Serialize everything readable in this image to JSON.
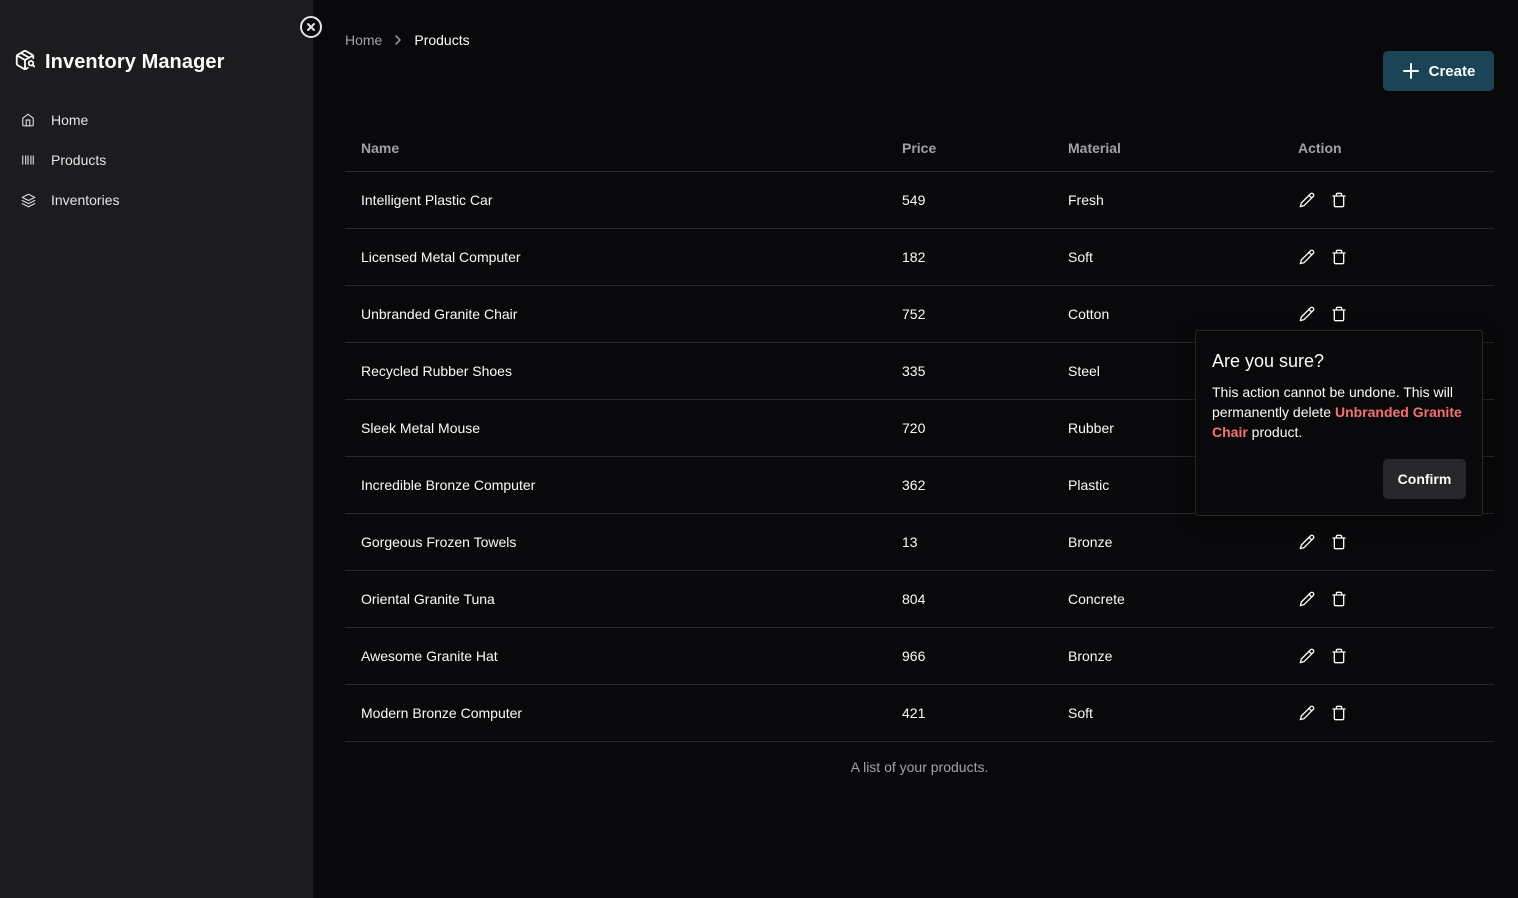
{
  "app": {
    "title": "Inventory Manager",
    "logo_icon": "package-search-icon"
  },
  "sidebar": {
    "close_icon": "close-circle-icon",
    "items": [
      {
        "label": "Home",
        "icon": "home-icon"
      },
      {
        "label": "Products",
        "icon": "barcode-icon"
      },
      {
        "label": "Inventories",
        "icon": "layers-icon"
      }
    ]
  },
  "breadcrumb": {
    "home": "Home",
    "separator_icon": "chevron-right-icon",
    "current": "Products"
  },
  "toolbar": {
    "create_label": "Create",
    "create_icon": "plus-icon"
  },
  "table": {
    "columns": [
      "Name",
      "Price",
      "Material",
      "Action"
    ],
    "rows": [
      {
        "name": "Intelligent Plastic Car",
        "price": "549",
        "material": "Fresh"
      },
      {
        "name": "Licensed Metal Computer",
        "price": "182",
        "material": "Soft"
      },
      {
        "name": "Unbranded Granite Chair",
        "price": "752",
        "material": "Cotton"
      },
      {
        "name": "Recycled Rubber Shoes",
        "price": "335",
        "material": "Steel"
      },
      {
        "name": "Sleek Metal Mouse",
        "price": "720",
        "material": "Rubber"
      },
      {
        "name": "Incredible Bronze Computer",
        "price": "362",
        "material": "Plastic"
      },
      {
        "name": "Gorgeous Frozen Towels",
        "price": "13",
        "material": "Bronze"
      },
      {
        "name": "Oriental Granite Tuna",
        "price": "804",
        "material": "Concrete"
      },
      {
        "name": "Awesome Granite Hat",
        "price": "966",
        "material": "Bronze"
      },
      {
        "name": "Modern Bronze Computer",
        "price": "421",
        "material": "Soft"
      }
    ],
    "action_icons": [
      "pencil-icon",
      "trash-icon"
    ],
    "caption": "A list of your products."
  },
  "dialog": {
    "title": "Are you sure?",
    "body_prefix": "This action cannot be undone. This will permanently delete ",
    "highlight": "Unbranded Granite Chair",
    "body_suffix": " product.",
    "confirm_label": "Confirm"
  },
  "colors": {
    "background": "#09090b",
    "sidebar": "#1c1c1e",
    "primary_button": "#1b4457",
    "danger_text": "#f87171",
    "muted_text": "#a1a1aa",
    "border": "#27272a"
  }
}
